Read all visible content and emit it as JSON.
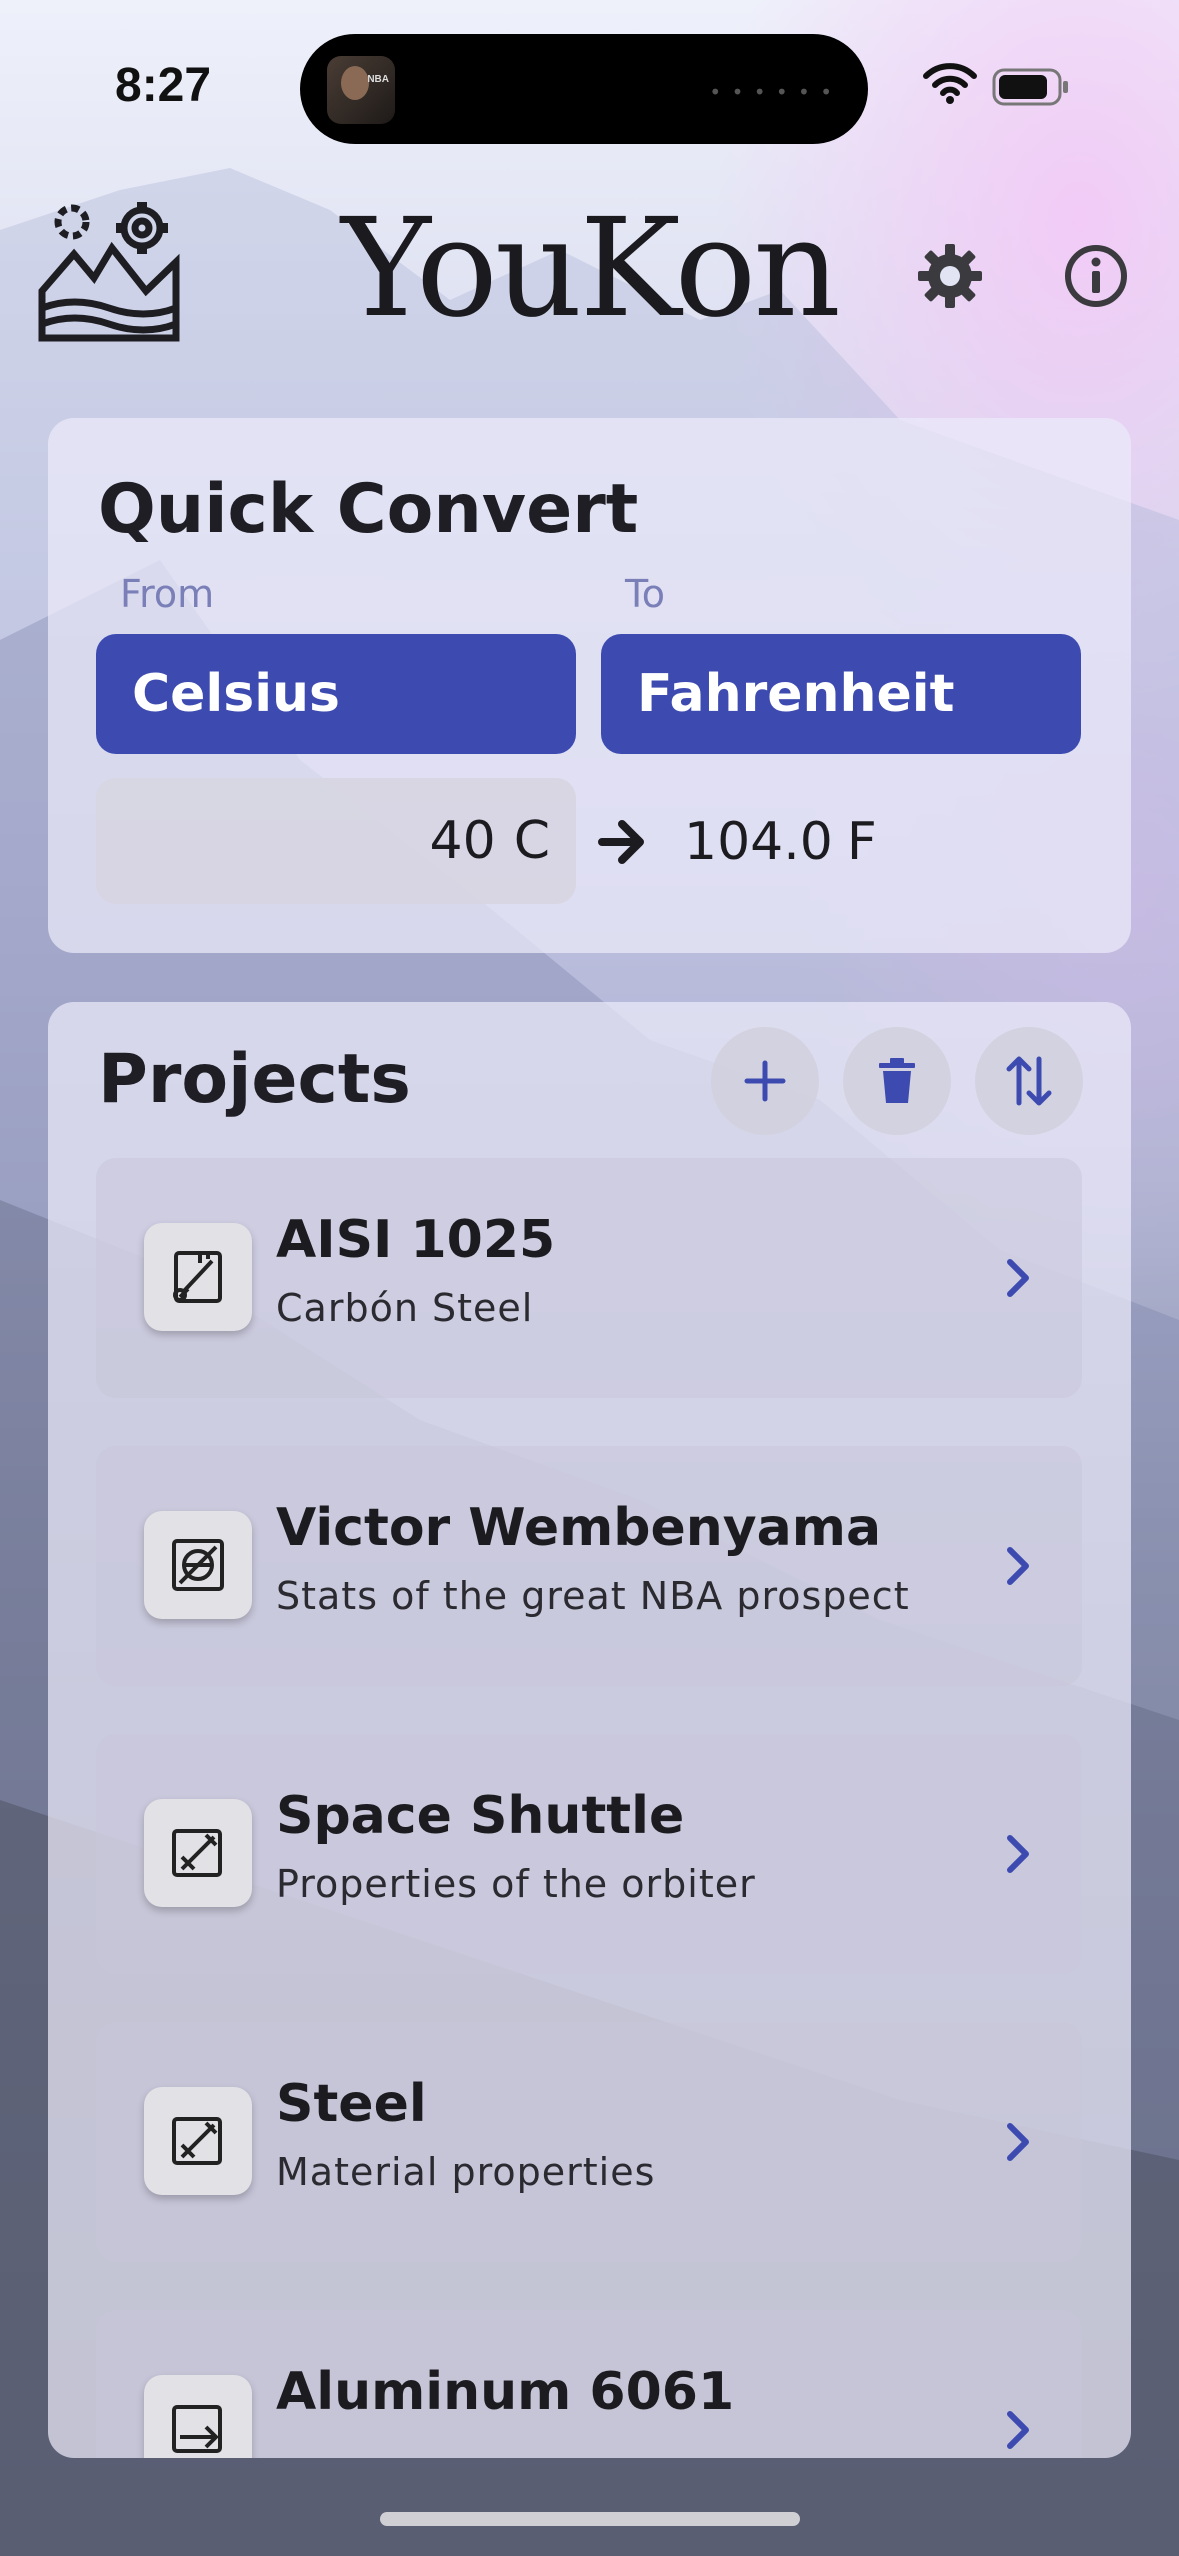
{
  "status_bar": {
    "time": "8:27",
    "island_label": "NBA"
  },
  "header": {
    "title": "YouKon"
  },
  "quick_convert": {
    "title": "Quick Convert",
    "from_label": "From",
    "to_label": "To",
    "from_unit": "Celsius",
    "to_unit": "Fahrenheit",
    "input_value": "40",
    "input_unit": "C",
    "result_value": "104.0",
    "result_unit": "F"
  },
  "projects": {
    "title": "Projects",
    "items": [
      {
        "title": "AISI 1025",
        "subtitle": "Carbón Steel"
      },
      {
        "title": "Victor Wembenyama",
        "subtitle": "Stats of the great NBA prospect"
      },
      {
        "title": "Space Shuttle",
        "subtitle": "Properties of the orbiter"
      },
      {
        "title": "Steel",
        "subtitle": "Material properties"
      },
      {
        "title": "Aluminum 6061",
        "subtitle": ""
      }
    ]
  },
  "colors": {
    "accent": "#3d4bb1",
    "label": "#7a7fb8",
    "text": "#1c1c20"
  }
}
